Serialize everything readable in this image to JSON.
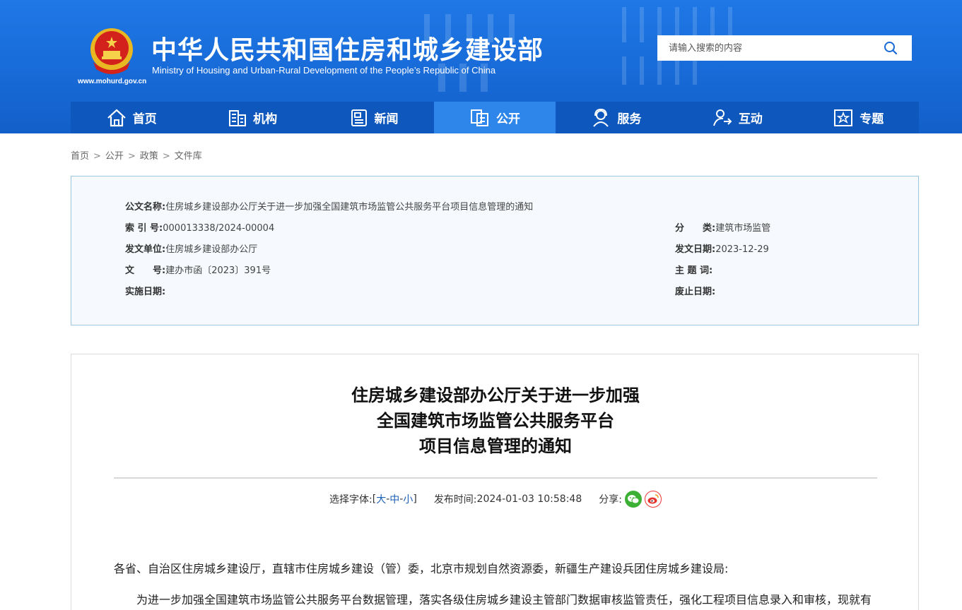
{
  "header": {
    "site_title": "中华人民共和国住房和城乡建设部",
    "site_subtitle": "Ministry of Housing and Urban-Rural Development of the People’s Republic of China",
    "site_url": "www.mohurd.gov.cn",
    "search_placeholder": "请输入搜索的内容"
  },
  "nav": [
    {
      "label": "首页",
      "icon": "home-icon"
    },
    {
      "label": "机构",
      "icon": "building-icon"
    },
    {
      "label": "新闻",
      "icon": "news-icon"
    },
    {
      "label": "公开",
      "icon": "document-icon",
      "active": true
    },
    {
      "label": "服务",
      "icon": "service-icon"
    },
    {
      "label": "互动",
      "icon": "user-interaction-icon"
    },
    {
      "label": "专题",
      "icon": "star-topic-icon"
    }
  ],
  "breadcrumb": [
    "首页",
    "公开",
    "政策",
    "文件库"
  ],
  "meta": {
    "name_k": "公文名称:",
    "name_v": "住房城乡建设部办公厅关于进一步加强全国建筑市场监管公共服务平台项目信息管理的通知",
    "index_k": "索 引 号:",
    "index_v": "000013338/2024-00004",
    "category_k": "分　　类:",
    "category_v": "建筑市场监管",
    "issuer_k": "发文单位:",
    "issuer_v": "住房城乡建设部办公厅",
    "date_k": "发文日期:",
    "date_v": "2023-12-29",
    "docno_k": "文　　号:",
    "docno_v": "建办市函〔2023〕391号",
    "keywords_k": "主 题 词:",
    "keywords_v": "",
    "effective_k": "实施日期:",
    "effective_v": "",
    "expiry_k": "废止日期:",
    "expiry_v": ""
  },
  "article": {
    "title_line1": "住房城乡建设部办公厅关于进一步加强",
    "title_line2": "全国建筑市场监管公共服务平台",
    "title_line3": "项目信息管理的通知",
    "font_label": "选择字体:",
    "font_open": "[",
    "font_large": "大",
    "font_medium": "中",
    "font_small": "小",
    "font_dash": "-",
    "font_close": "]",
    "publish_label": "发布时间:",
    "publish_time": "2024-01-03 10:58:48",
    "share_label": "分享:",
    "salutation": "各省、自治区住房城乡建设厅，直辖市住房城乡建设（管）委，北京市规划自然资源委，新疆生产建设兵团住房城乡建设局:",
    "body_first": "为进一步加强全国建筑市场监管公共服务平台数据管理，落实各级住房城乡建设主管部门数据审核监管责任，强化工程项目信息录入和审核，现就有"
  },
  "colors": {
    "header_blue": "#1769d6",
    "nav_blue": "#0e58bd",
    "nav_active": "#2f86ea",
    "link_blue": "#1a5fb4"
  }
}
